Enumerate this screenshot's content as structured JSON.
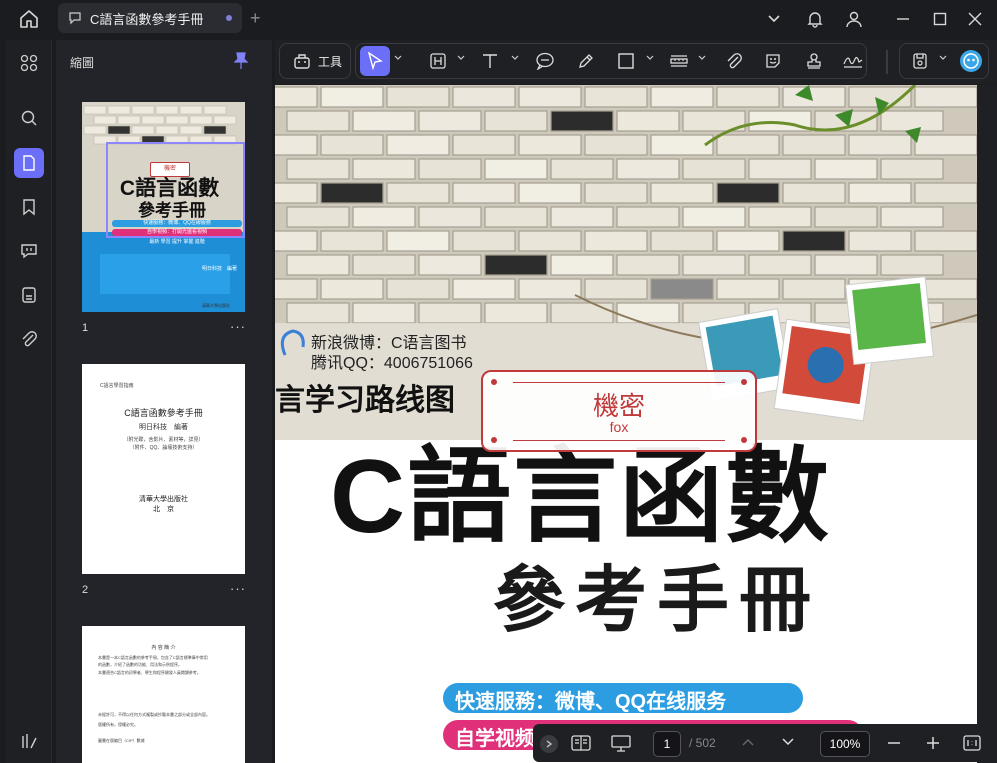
{
  "tab": {
    "title": "C語言函數參考手冊"
  },
  "panel": {
    "title": "縮圖"
  },
  "toolbar": {
    "tools_label": "工具"
  },
  "pages": [
    {
      "number": "1",
      "more": "···"
    },
    {
      "number": "2",
      "more": "···"
    }
  ],
  "page2": {
    "header": "C語言學習指南",
    "title": "C語言函數參考手冊",
    "author": "明日科技　編著",
    "meta1": "（附光碟，含影片、素材等，詳見）",
    "meta2": "（附件、QQ、論壇技術支持）",
    "publisher": "清華大學出版社",
    "city": "北　京"
  },
  "page3": {
    "heading": "內 容 簡 介",
    "lines": [
      "本書是一本C語言函數的參考手冊，包含了C語言標準庫中常用",
      "的函數，介紹了函數的功能、用法和示例程序。",
      "本書適合C語言的初學者、學生和程序開發人員閱讀參考。",
      "未經許可，不得以任何方式複製或抄襲本書之部分或全部內容。",
      "版權所有，侵權必究。"
    ],
    "footer": "圖書在版編目（CIP）數據"
  },
  "cover": {
    "weibo": "新浪微博：C语言图书",
    "qq": "腾讯QQ：4006751066",
    "roadmap": "言学习路线图",
    "title": "C語言函數",
    "subtitle": "參考手冊",
    "banner1": "快速服務：微博、QQ在线服务",
    "banner2": "自学视频",
    "thumb_banner1": "快速服務：微博、QQ在線服務",
    "thumb_banner2": "自學視頻：打開光盤看視頻",
    "thumb_line": "最新 學習 提升 掌握 進階"
  },
  "stamp": {
    "title": "機密",
    "sub": "fox"
  },
  "bottom": {
    "page": "1",
    "total": "/ 502",
    "zoom": "100%"
  },
  "colors": {
    "accent": "#6b6ef6",
    "stamp": "#c0393b",
    "banner_blue": "#2b9de0",
    "banner_pink": "#e0307a",
    "cover_blue": "#1e8ed6"
  }
}
